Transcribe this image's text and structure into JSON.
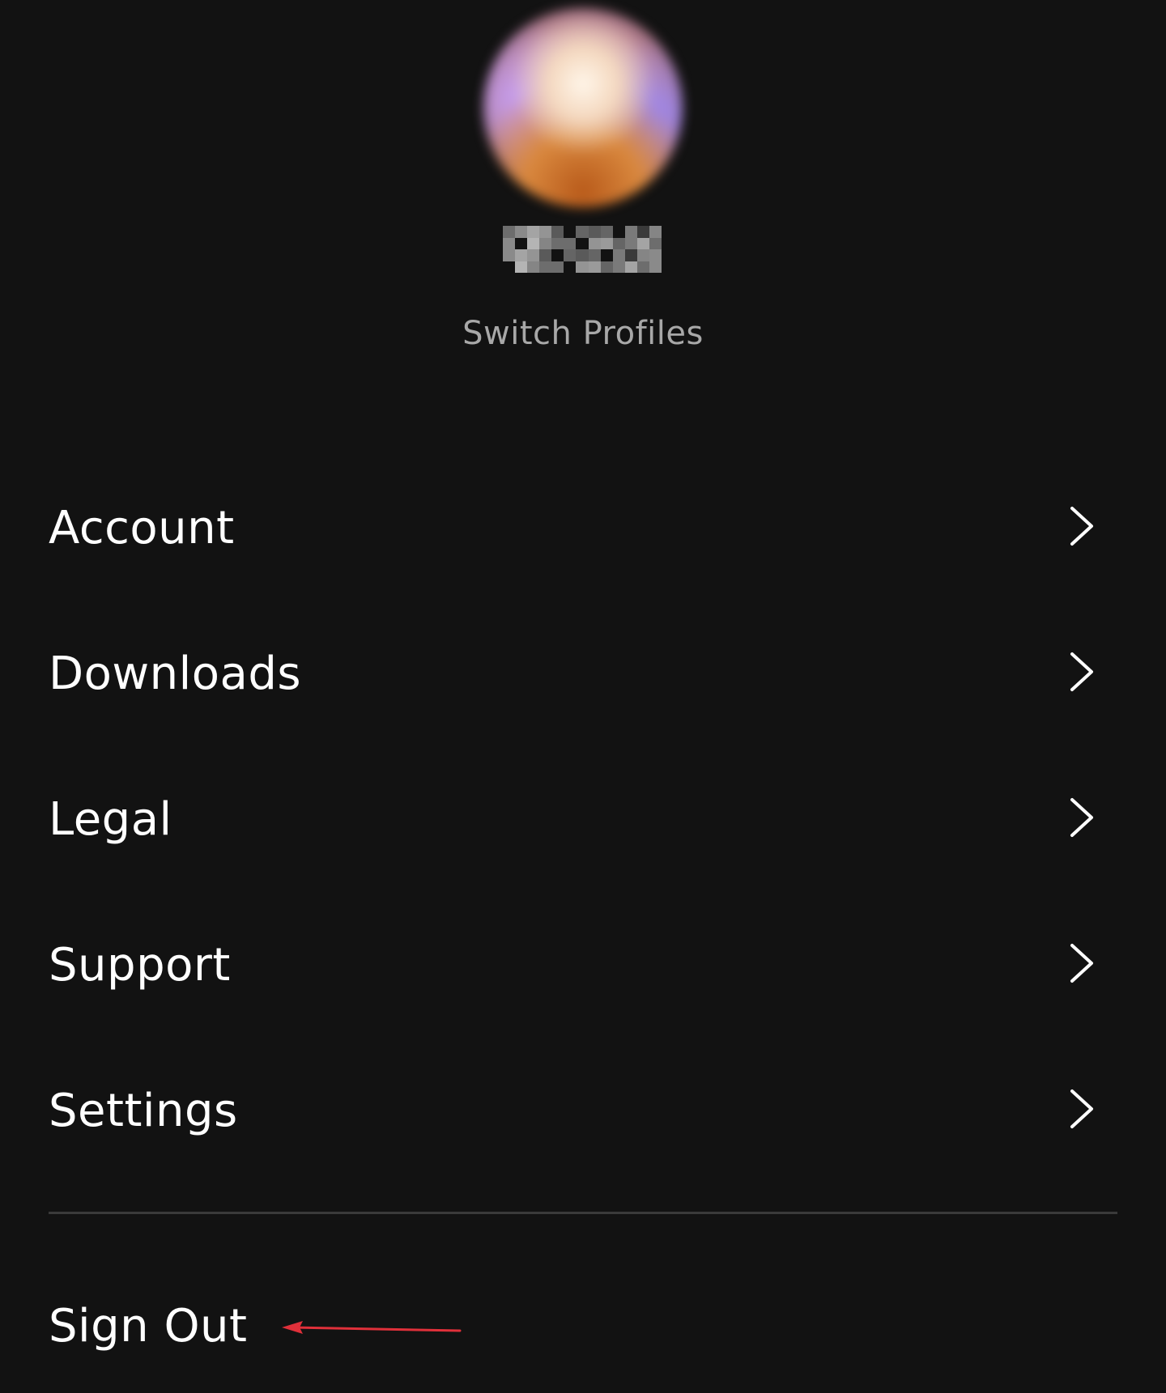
{
  "profile": {
    "switch_label": "Switch Profiles"
  },
  "menu": {
    "items": [
      {
        "label": "Account",
        "icon": "chevron-right-icon"
      },
      {
        "label": "Downloads",
        "icon": "chevron-right-icon"
      },
      {
        "label": "Legal",
        "icon": "chevron-right-icon"
      },
      {
        "label": "Support",
        "icon": "chevron-right-icon"
      },
      {
        "label": "Settings",
        "icon": "chevron-right-icon"
      }
    ]
  },
  "footer": {
    "sign_out_label": "Sign Out"
  },
  "colors": {
    "background": "#121212",
    "text": "#ffffff",
    "muted_text": "#a8a8a8",
    "divider": "#3a3a3a",
    "annotation": "#e0303a"
  }
}
